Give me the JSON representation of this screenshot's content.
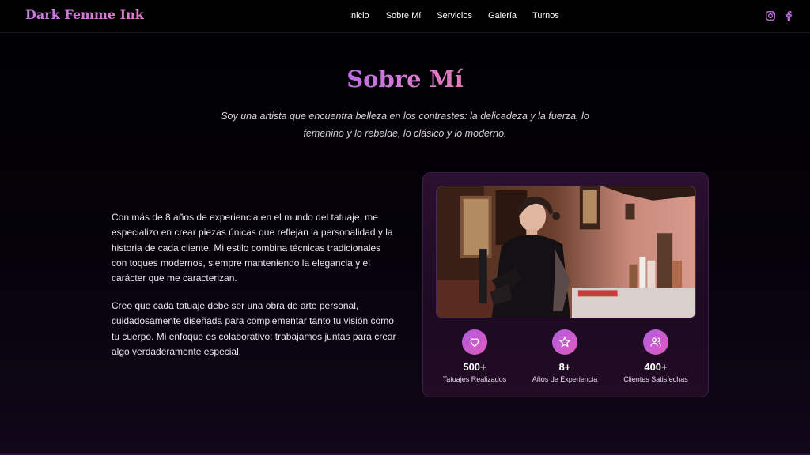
{
  "nav": {
    "brand": "Dark Femme Ink",
    "items": [
      {
        "label": "Inicio"
      },
      {
        "label": "Sobre Mí"
      },
      {
        "label": "Servicios"
      },
      {
        "label": "Galería"
      },
      {
        "label": "Turnos"
      }
    ],
    "social": [
      "instagram-icon",
      "facebook-icon"
    ]
  },
  "about": {
    "title": "Sobre Mí",
    "intro": "Soy una artista que encuentra belleza en los contrastes: la delicadeza y la fuerza, lo femenino y lo rebelde, lo clásico y lo moderno.",
    "paragraph_1": "Con más de 8 años de experiencia en el mundo del tatuaje, me especializo en crear piezas únicas que reflejan la personalidad y la historia de cada cliente. Mi estilo combina técnicas tradicionales con toques modernos, siempre manteniendo la elegancia y el carácter que me caracterizan.",
    "paragraph_2": "Creo que cada tatuaje debe ser una obra de arte personal, cuidadosamente diseñada para complementar tanto tu visión como tu cuerpo. Mi enfoque es colaborativo: trabajamos juntas para crear algo verdaderamente especial."
  },
  "stats": [
    {
      "icon": "heart-icon",
      "value": "500+",
      "label": "Tatuajes Realizados"
    },
    {
      "icon": "star-icon",
      "value": "8+",
      "label": "Años de Experiencia"
    },
    {
      "icon": "users-icon",
      "value": "400+",
      "label": "Clientes Satisfechas"
    }
  ],
  "colors": {
    "accent": "#c46ee0",
    "accent_pink": "#e05bbf",
    "background": "#000000",
    "card": "#241028"
  }
}
